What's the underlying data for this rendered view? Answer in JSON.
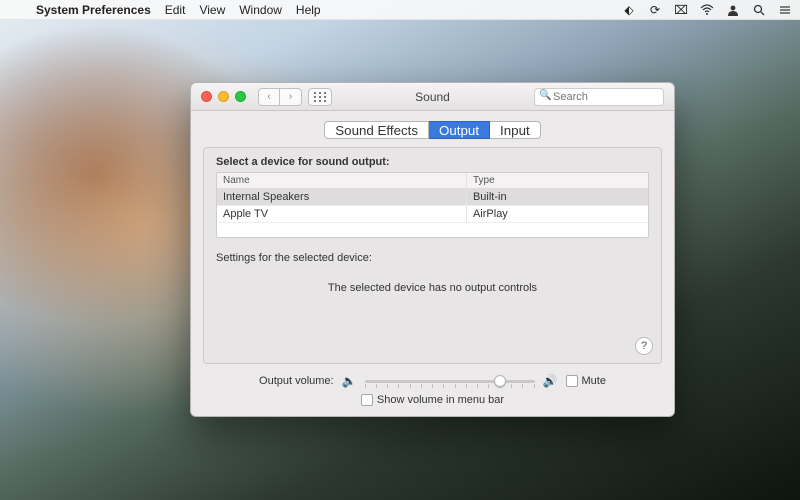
{
  "menubar": {
    "app": "System Preferences",
    "items": [
      "Edit",
      "View",
      "Window",
      "Help"
    ]
  },
  "window": {
    "title": "Sound",
    "search_placeholder": "Search",
    "tabs": [
      "Sound Effects",
      "Output",
      "Input"
    ],
    "active_tab": 1,
    "heading": "Select a device for sound output:",
    "columns": {
      "name": "Name",
      "type": "Type"
    },
    "devices": [
      {
        "name": "Internal Speakers",
        "type": "Built-in",
        "selected": true
      },
      {
        "name": "Apple TV",
        "type": "AirPlay",
        "selected": false
      }
    ],
    "settings_label": "Settings for the selected device:",
    "no_controls_msg": "The selected device has no output controls",
    "output_volume_label": "Output volume:",
    "volume_percent": 82,
    "mute_label": "Mute",
    "mute_checked": false,
    "show_in_menubar_label": "Show volume in menu bar",
    "show_in_menubar_checked": false
  }
}
